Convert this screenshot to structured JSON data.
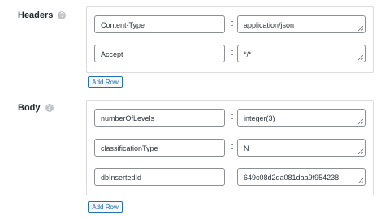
{
  "headers": {
    "label": "Headers",
    "help": "?",
    "rows": [
      {
        "key": "Content-Type",
        "separator": ":",
        "value": "application/json"
      },
      {
        "key": "Accept",
        "separator": ":",
        "value": "*/*"
      }
    ],
    "add_row_label": "Add Row"
  },
  "body": {
    "label": "Body",
    "help": "?",
    "rows": [
      {
        "key": "numberOfLevels",
        "separator": ":",
        "value": "integer(3)"
      },
      {
        "key": "classificationType",
        "separator": ":",
        "value": "N"
      },
      {
        "key": "dbInsertedId",
        "separator": ":",
        "value": "649c08d2da081daa9f954238"
      }
    ],
    "add_row_label": "Add Row"
  }
}
